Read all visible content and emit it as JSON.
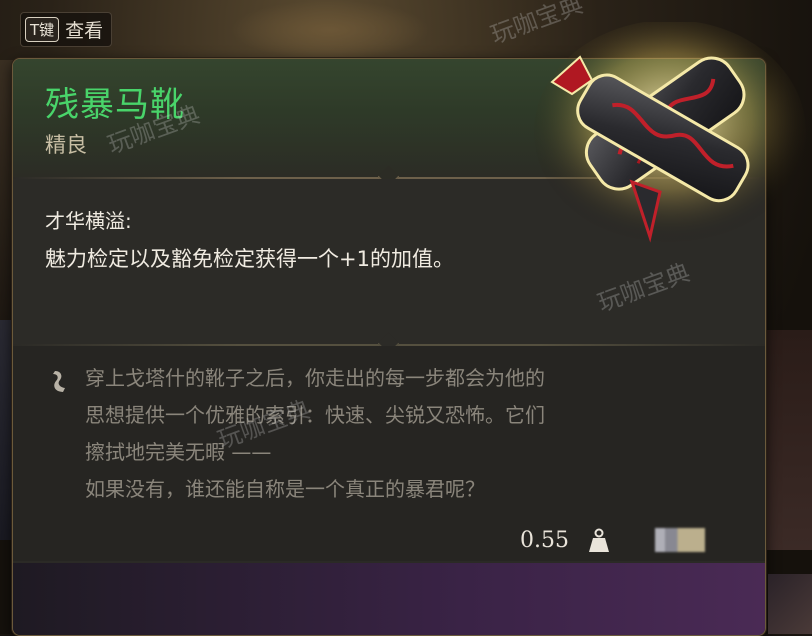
{
  "hint": {
    "key": "T键",
    "label": "查看"
  },
  "item": {
    "name": "残暴马靴",
    "rarity": "精良",
    "feature_name": "才华横溢:",
    "feature_desc": "魅力检定以及豁免检定获得一个+1的加值。",
    "lore_lines": [
      "穿上戈塔什的靴子之后，你走出的每一步都会为他的",
      "思想提供一个优雅的索引：快速、尖锐又恐怖。它们",
      "擦拭地完美无暇 ——",
      "如果没有，谁还能自称是一个真正的暴君呢？"
    ],
    "weight": "0.55"
  },
  "watermark": "玩咖宝典",
  "colors": {
    "title": "#49d46a",
    "rarity": "#c9bfa5",
    "lore": "#8a857b"
  },
  "icons": {
    "quote": "quote-mark-icon",
    "weight": "weight-icon",
    "item": "boots-item-icon"
  }
}
